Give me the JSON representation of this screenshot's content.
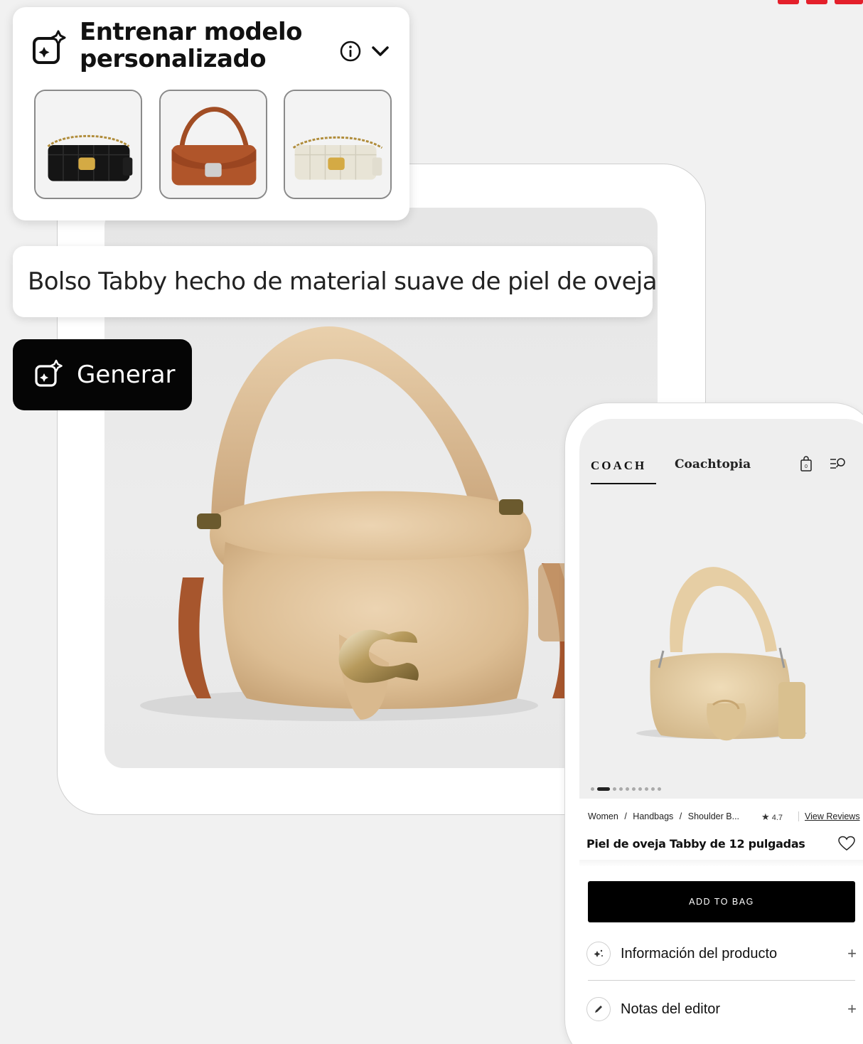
{
  "colors": {
    "accent": "#e4202b",
    "dark_button": "#050505",
    "panel": "#ffffff",
    "background": "#f1f1f1"
  },
  "train_panel": {
    "title": "Entrenar modelo personalizado",
    "icons": {
      "left": "sparkle-image-icon",
      "info": "info-icon",
      "toggle": "chevron-down-icon"
    },
    "thumbnails": [
      {
        "label": "black-quilted-tabby"
      },
      {
        "label": "brown-leather-tabby"
      },
      {
        "label": "white-quilted-tabby"
      }
    ]
  },
  "prompt": {
    "value": "Bolso Tabby hecho de material suave de piel de oveja"
  },
  "generate": {
    "label": "Generar",
    "icon": "sparkle-image-icon"
  },
  "phone": {
    "brand": "COACH",
    "brand_secondary": "Coachtopia",
    "icons": {
      "bag": "bag-icon",
      "menu": "menu-search-icon"
    },
    "carousel": {
      "count": 10,
      "active_index": 1
    },
    "breadcrumb": [
      "Women",
      "/",
      "Handbags",
      "/",
      "Shoulder B..."
    ],
    "rating": "4.7",
    "review_link": "View Reviews",
    "product_title": "Piel de oveja Tabby de 12 pulgadas",
    "add_to_bag": "ADD TO BAG",
    "accordion": [
      {
        "label": "Información del producto",
        "icon": "sparkle-icon",
        "toggle": "+"
      },
      {
        "label": "Notas del editor",
        "icon": "pencil-icon",
        "toggle": "+"
      }
    ]
  }
}
